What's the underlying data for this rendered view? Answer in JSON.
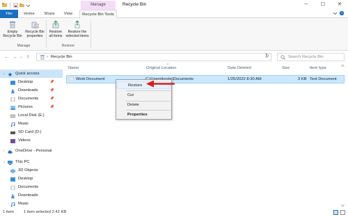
{
  "window": {
    "title": "Recycle Bin",
    "contextual_group": "Manage",
    "controls": {
      "minimize": "─",
      "maximize": "☐",
      "close": "✕"
    }
  },
  "ribbon_tabs": {
    "file": "File",
    "home": "Home",
    "share": "Share",
    "view": "View",
    "recycle_bin_tools": "Recycle Bin Tools"
  },
  "ribbon": {
    "manage_group": {
      "label": "Manage",
      "empty_recycle_bin": "Empty Recycle Bin",
      "recycle_bin_properties": "Recycle Bin properties"
    },
    "restore_group": {
      "label": "Restore",
      "restore_all_items": "Restore all items",
      "restore_selected_items": "Restore the selected items"
    }
  },
  "address_bar": {
    "back": "←",
    "forward": "→",
    "recent": "⌄",
    "up": "↑",
    "path": "Recycle Bin",
    "separator": "›",
    "dropdown": "⌄",
    "refresh": "↻",
    "search_placeholder": "Search Recycle Bin"
  },
  "sidebar": {
    "quick_access": "Quick access",
    "quick_items": [
      {
        "label": "Desktop",
        "pinned": "📌"
      },
      {
        "label": "Downloads",
        "pinned": "📌"
      },
      {
        "label": "Documents",
        "pinned": "📌"
      },
      {
        "label": "Pictures",
        "pinned": "📌"
      },
      {
        "label": "Local Disk (E:)"
      },
      {
        "label": "Music"
      },
      {
        "label": "SD Card (D:)"
      },
      {
        "label": "Videos"
      }
    ],
    "onedrive": "OneDrive - Personal",
    "this_pc": "This PC",
    "pc_items": [
      {
        "label": "3D Objects"
      },
      {
        "label": "Desktop"
      },
      {
        "label": "Documents"
      },
      {
        "label": "Downloads"
      },
      {
        "label": "Music"
      }
    ],
    "expand_chevron": "›",
    "expanded_chevron": "⌄"
  },
  "file_list": {
    "columns": {
      "name": "Name",
      "original_location": "Original Location",
      "date_deleted": "Date Deleted",
      "size": "Size",
      "item_type": "Item type"
    },
    "sort_indicator": "^",
    "rows": [
      {
        "name": "Work Document",
        "original_location": "C:\\Users\\koste\\Documents",
        "date_deleted": "1/25/2022 8:30 AM",
        "size": "3 KB",
        "item_type": "Text Document"
      }
    ]
  },
  "context_menu": {
    "restore": "Restore",
    "cut": "Cut",
    "delete": "Delete",
    "properties": "Properties"
  },
  "status_bar": {
    "item_count": "1 item",
    "selection": "1 item selected  2.42 KB"
  },
  "colors": {
    "accent": "#1a6ec0",
    "selection": "#cce8ff",
    "manage_tab": "#f5dcf7",
    "annotation_arrow": "#d91e1e"
  }
}
